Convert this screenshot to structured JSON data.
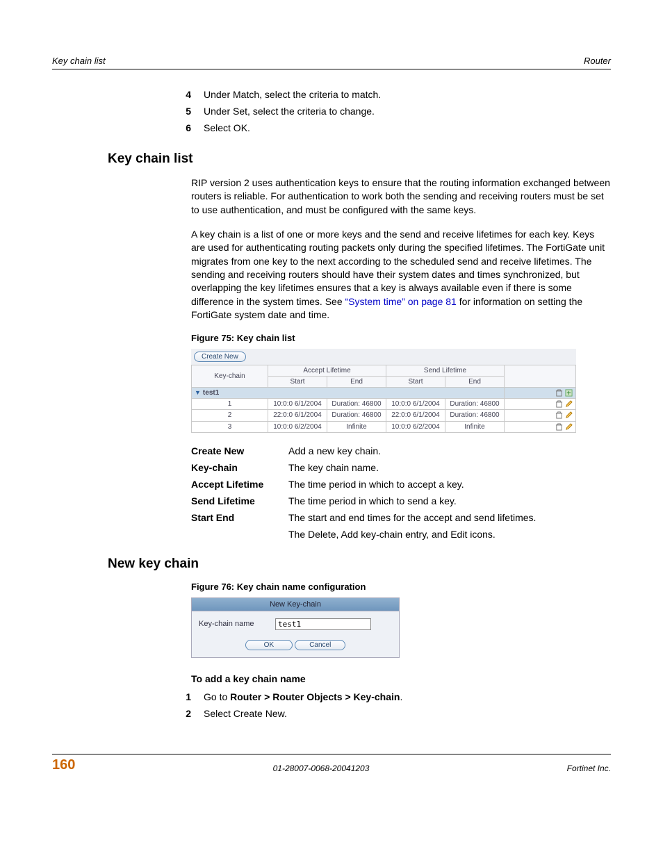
{
  "header": {
    "left": "Key chain list",
    "right": "Router"
  },
  "steps_top": [
    {
      "n": "4",
      "t": "Under Match, select the criteria to match."
    },
    {
      "n": "5",
      "t": "Under Set, select the criteria to change."
    },
    {
      "n": "6",
      "t": "Select OK."
    }
  ],
  "h2a": "Key chain list",
  "para1": "RIP version 2 uses authentication keys to ensure that the routing information exchanged between routers is reliable. For authentication to work both the sending and receiving routers must be set to use authentication, and must be configured with the same keys.",
  "para2a": "A key chain is a list of one or more keys and the send and receive lifetimes for each key. Keys are used for authenticating routing packets only during the specified lifetimes. The FortiGate unit migrates from one key to the next according to the scheduled send and receive lifetimes. The sending and receiving routers should have their system dates and times synchronized, but overlapping the key lifetimes ensures that a key is always available even if there is some difference in the system times. See ",
  "para2link": "“System time” on page 81",
  "para2b": " for information on setting the FortiGate system date and time.",
  "fig75": {
    "caption": "Figure 75: Key chain list",
    "create_btn": "Create New",
    "cols": {
      "keychain": "Key-chain",
      "accept": "Accept Lifetime",
      "send": "Send Lifetime",
      "start": "Start",
      "end": "End"
    },
    "group": "test1",
    "rows": [
      {
        "id": "1",
        "as": "10:0:0 6/1/2004",
        "ae": "Duration: 46800",
        "ss": "10:0:0 6/1/2004",
        "se": "Duration: 46800",
        "icons": [
          "delete",
          "edit"
        ]
      },
      {
        "id": "2",
        "as": "22:0:0 6/1/2004",
        "ae": "Duration: 46800",
        "ss": "22:0:0 6/1/2004",
        "se": "Duration: 46800",
        "icons": [
          "delete",
          "edit"
        ]
      },
      {
        "id": "3",
        "as": "10:0:0 6/2/2004",
        "ae": "Infinite",
        "ss": "10:0:0 6/2/2004",
        "se": "Infinite",
        "icons": [
          "delete",
          "edit"
        ]
      }
    ],
    "group_icons": [
      "delete",
      "add"
    ]
  },
  "defs": [
    {
      "term": "Create New",
      "desc": "Add a new key chain."
    },
    {
      "term": "Key-chain",
      "desc": "The key chain name."
    },
    {
      "term": "Accept Lifetime",
      "desc": "The time period in which to accept a key."
    },
    {
      "term": "Send Lifetime",
      "desc": "The time period in which to send a key."
    },
    {
      "term": "Start End",
      "desc": "The start and end times for the accept and send lifetimes."
    },
    {
      "term": "",
      "desc": "The Delete, Add key-chain entry, and Edit icons."
    }
  ],
  "h2b": "New key chain",
  "fig76": {
    "caption": "Figure 76: Key chain name configuration",
    "title": "New Key-chain",
    "label": "Key-chain name",
    "value": "test1",
    "ok": "OK",
    "cancel": "Cancel"
  },
  "subhead": "To add a key chain name",
  "steps_bottom": [
    {
      "n": "1",
      "t_a": "Go to ",
      "t_bold": "Router > Router Objects > Key-chain",
      "t_b": "."
    },
    {
      "n": "2",
      "t_a": "Select Create New.",
      "t_bold": "",
      "t_b": ""
    }
  ],
  "footer": {
    "page": "160",
    "mid": "01-28007-0068-20041203",
    "right": "Fortinet Inc."
  }
}
